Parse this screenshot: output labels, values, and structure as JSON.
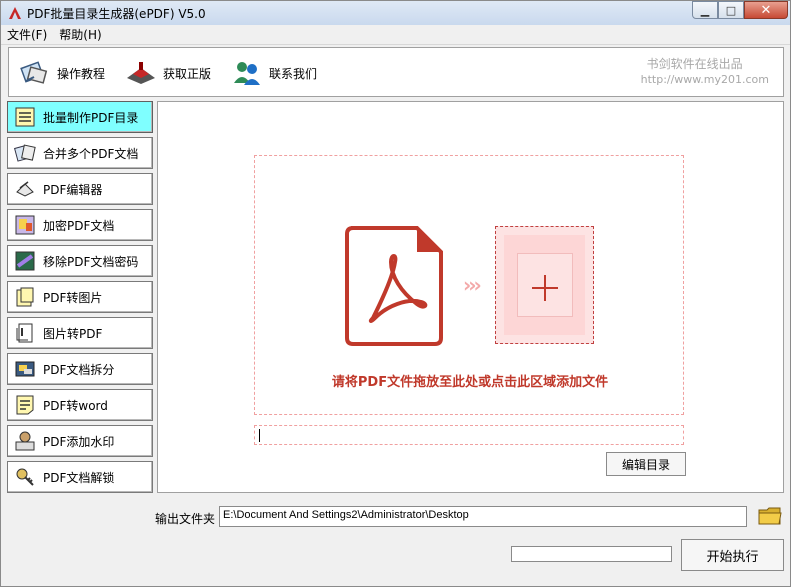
{
  "window": {
    "title": "PDF批量目录生成器(ePDF) V5.0",
    "controls": {
      "minimize": "▭",
      "maximize": "□",
      "close": "✕"
    }
  },
  "menu": [
    {
      "label": "文件(F)"
    },
    {
      "label": "帮助(H)"
    }
  ],
  "toolbar": {
    "items": [
      {
        "label": "操作教程",
        "icon": "tutorial-icon"
      },
      {
        "label": "获取正版",
        "icon": "stamp-icon"
      },
      {
        "label": "联系我们",
        "icon": "contact-icon"
      }
    ],
    "brand": {
      "line1": "书剑软件在线出品",
      "line2": "http://www.my201.com"
    }
  },
  "sidebar": {
    "items": [
      {
        "label": "批量制作PDF目录",
        "active": true
      },
      {
        "label": "合并多个PDF文档",
        "active": false
      },
      {
        "label": "PDF编辑器",
        "active": false
      },
      {
        "label": "加密PDF文档",
        "active": false
      },
      {
        "label": "移除PDF文档密码",
        "active": false
      },
      {
        "label": "PDF转图片",
        "active": false
      },
      {
        "label": "图片转PDF",
        "active": false
      },
      {
        "label": "PDF文档拆分",
        "active": false
      },
      {
        "label": "PDF转word",
        "active": false
      },
      {
        "label": "PDF添加水印",
        "active": false
      },
      {
        "label": "PDF文档解锁",
        "active": false
      }
    ]
  },
  "main": {
    "arrows": "›››",
    "drop_hint": "请将PDF文件拖放至此处或点击此区域添加文件",
    "path_value": "",
    "edit_button": "编辑目录"
  },
  "output": {
    "label": "输出文件夹",
    "path": "E:\\Document And Settings2\\Administrator\\Desktop"
  },
  "progress": {
    "value_percent": 0
  },
  "start_button": "开始执行",
  "colors": {
    "accent_red": "#c0392b",
    "active_tab": "#7fffff",
    "dashed_border": "#f0a0a0"
  }
}
